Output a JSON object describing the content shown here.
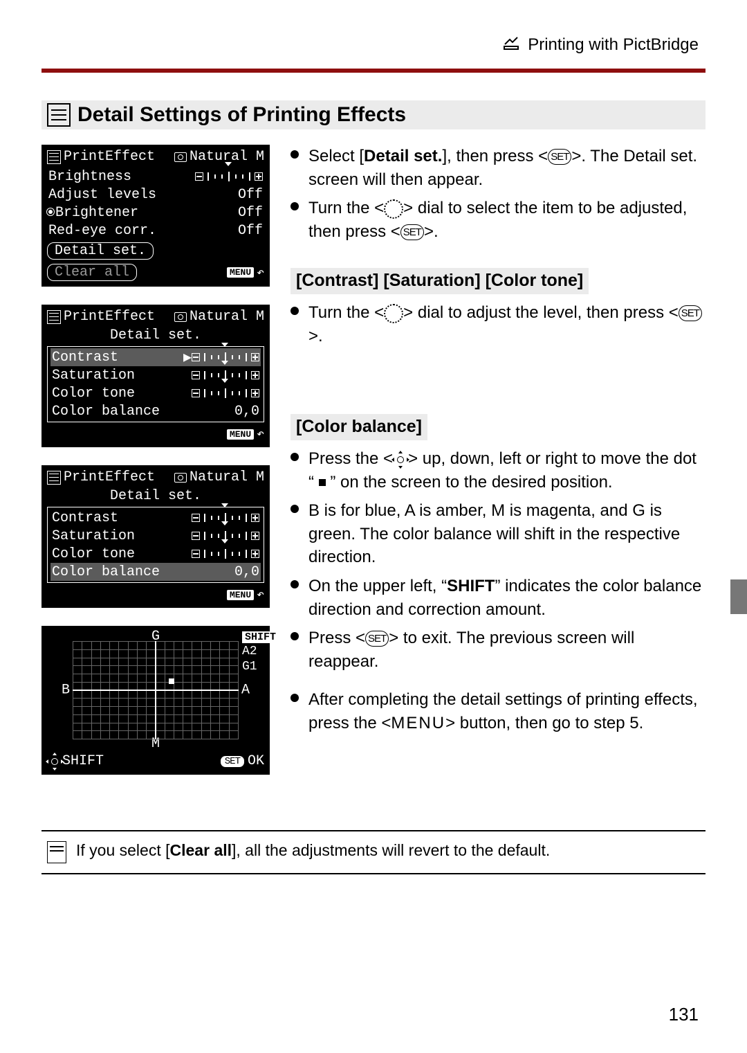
{
  "header": {
    "breadcrumb": "Printing with PictBridge",
    "icon": "pictbridge-icon"
  },
  "section_title": "Detail Settings of Printing Effects",
  "section_icon": "list-icon",
  "panels": {
    "p1": {
      "title_left": "PrintEffect",
      "title_right": "Natural M",
      "rows": [
        {
          "label": "Brightness",
          "value": "slider"
        },
        {
          "label": "Adjust levels",
          "value": "Off"
        },
        {
          "label": "Brightener",
          "value": "Off",
          "icon": "face-brightener-icon"
        },
        {
          "label": "Red-eye corr.",
          "value": "Off"
        }
      ],
      "detail_btn": "Detail set.",
      "clear_btn": "Clear all",
      "menu": "MENU"
    },
    "p2": {
      "title_left": "PrintEffect",
      "title_right": "Natural M",
      "subtitle": "Detail set.",
      "rows": [
        {
          "label": "Contrast",
          "selected": true
        },
        {
          "label": "Saturation"
        },
        {
          "label": "Color tone"
        },
        {
          "label": "Color balance",
          "value": "0,0"
        }
      ],
      "menu": "MENU"
    },
    "p3": {
      "title_left": "PrintEffect",
      "title_right": "Natural M",
      "subtitle": "Detail set.",
      "rows": [
        {
          "label": "Contrast"
        },
        {
          "label": "Saturation"
        },
        {
          "label": "Color tone"
        },
        {
          "label": "Color balance",
          "value": "0,0",
          "selected": true
        }
      ],
      "menu": "MENU"
    },
    "cb": {
      "axes": {
        "top": "G",
        "bottom": "M",
        "left": "B",
        "right": "A"
      },
      "shift_label": "SHIFT",
      "shift_values": [
        "A2",
        "G1"
      ],
      "shift_footer": "SHIFT",
      "ok_label": "OK",
      "set_label": "SET"
    }
  },
  "body": {
    "intro": [
      "Select [Detail set.], then press <SET>. The Detail set. screen will then appear.",
      "Turn the <dial> dial to select the item to be adjusted, then press <SET>."
    ],
    "sub1_title": "[Contrast] [Saturation] [Color tone]",
    "sub1": [
      "Turn the <dial> dial to adjust the level, then press <SET>."
    ],
    "sub2_title": "[Color balance]",
    "sub2": [
      "Press the <joy> up, down, left or right to move the dot \" ■ \" on the screen to the desired position.",
      "B is for blue, A is amber, M is magenta, and G is green. The color balance will shift in the respective direction.",
      "On the upper left, \"SHIFT\" indicates the color balance direction and correction amount.",
      "Press <SET> to exit. The previous screen will reappear."
    ],
    "closing": "After completing the detail settings of printing effects, press the <MENU> button, then go to step 5."
  },
  "note": "If you select [Clear all], all the adjustments will revert to the default.",
  "page_number": "131"
}
